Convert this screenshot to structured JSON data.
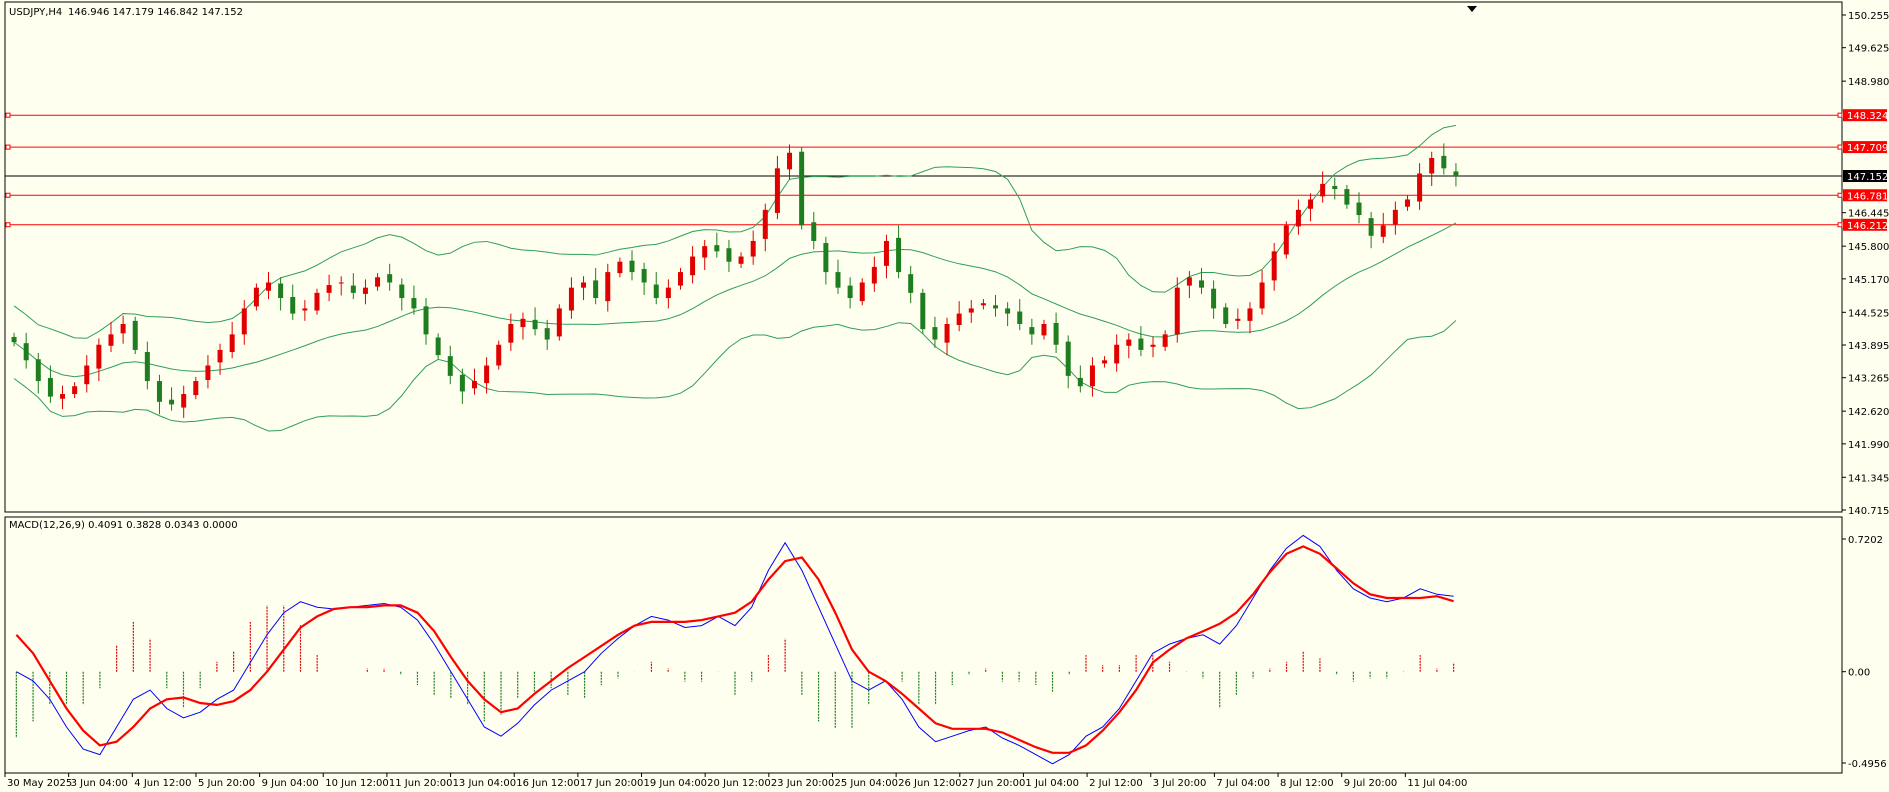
{
  "header": {
    "symbol_tf": "USDJPY,H4",
    "ohlc": "146.946 147.179 146.842 147.152"
  },
  "macd_header": {
    "label": "MACD(12,26,9) 0.4091 0.3828 0.0343 0.0000"
  },
  "price_axis": {
    "ticks": [
      "150.255",
      "149.625",
      "148.980",
      "148.324",
      "147.709",
      "147.152",
      "146.781",
      "146.445",
      "146.212",
      "145.800",
      "145.170",
      "144.525",
      "143.895",
      "143.265",
      "142.620",
      "141.990",
      "141.345",
      "140.715"
    ],
    "tick_values": [
      150.255,
      149.625,
      148.98,
      148.324,
      147.709,
      147.152,
      146.781,
      146.445,
      146.212,
      145.8,
      145.17,
      144.525,
      143.895,
      143.265,
      142.62,
      141.99,
      141.345,
      140.715
    ],
    "current_price": "147.152",
    "level_labels": [
      "148.324",
      "147.709",
      "146.781",
      "146.212"
    ]
  },
  "macd_axis": {
    "ticks": [
      "0.7202",
      "0.00",
      "-0.4956"
    ],
    "tick_values": [
      0.7202,
      0.0,
      -0.4956
    ]
  },
  "time_axis": {
    "labels": [
      "30 May 2025",
      "3 Jun 04:00",
      "4 Jun 12:00",
      "5 Jun 20:00",
      "9 Jun 04:00",
      "10 Jun 12:00",
      "11 Jun 20:00",
      "13 Jun 04:00",
      "16 Jun 12:00",
      "17 Jun 20:00",
      "19 Jun 04:00",
      "20 Jun 12:00",
      "23 Jun 20:00",
      "25 Jun 04:00",
      "26 Jun 12:00",
      "27 Jun 20:00",
      "1 Jul 04:00",
      "2 Jul 12:00",
      "3 Jul 20:00",
      "7 Jul 04:00",
      "8 Jul 12:00",
      "9 Jul 20:00",
      "11 Jul 04:00"
    ]
  },
  "colors": {
    "background": "#fffff0",
    "bull": "#e00000",
    "bear": "#1e7d1e",
    "bands": "#2e9e5a",
    "level": "#ff0000",
    "macd_line": "#0000ff",
    "signal_line": "#ff0000",
    "hist_pos": "#e00000",
    "hist_neg": "#1e7d1e"
  },
  "chart_data": {
    "type": "candlestick",
    "symbol": "USDJPY",
    "timeframe": "H4",
    "ylim": [
      140.715,
      150.255
    ],
    "horizontal_levels": [
      148.324,
      147.709,
      146.781,
      146.212
    ],
    "current_price": 147.152,
    "close_path": [
      143.95,
      143.6,
      143.2,
      142.9,
      142.95,
      143.1,
      143.5,
      143.9,
      144.1,
      144.3,
      143.8,
      143.2,
      142.8,
      142.75,
      142.95,
      143.2,
      143.5,
      143.8,
      144.1,
      144.6,
      145.0,
      145.1,
      144.8,
      144.5,
      144.6,
      144.9,
      145.05,
      145.1,
      144.9,
      145.0,
      145.2,
      145.1,
      144.8,
      144.6,
      144.1,
      143.7,
      143.3,
      143.0,
      143.2,
      143.5,
      143.9,
      144.3,
      144.4,
      144.2,
      144.0,
      144.6,
      145.0,
      145.1,
      144.8,
      145.3,
      145.5,
      145.3,
      145.1,
      144.8,
      145.0,
      145.3,
      145.6,
      145.8,
      145.7,
      145.5,
      145.6,
      145.9,
      146.5,
      147.3,
      147.6,
      146.2,
      145.9,
      145.3,
      145.0,
      144.8,
      145.1,
      145.4,
      145.9,
      145.3,
      144.9,
      144.2,
      144.0,
      144.3,
      144.5,
      144.6,
      144.7,
      144.6,
      144.5,
      144.3,
      144.1,
      144.3,
      143.9,
      143.3,
      143.1,
      143.5,
      143.6,
      143.9,
      144.0,
      143.8,
      143.9,
      144.1,
      145.0,
      145.2,
      145.0,
      144.6,
      144.3,
      144.4,
      144.6,
      145.1,
      145.7,
      146.2,
      146.5,
      146.7,
      147.0,
      146.9,
      146.6,
      146.4,
      146.0,
      146.2,
      146.5,
      146.7,
      147.2,
      147.5,
      147.3,
      147.152
    ],
    "bollinger": {
      "period": 20,
      "note": "upper/middle/lower bands drawn"
    },
    "macd": {
      "params": "12,26,9",
      "values": [
        0.4091,
        0.3828,
        0.0343,
        0.0
      ],
      "ylim": [
        -0.4956,
        0.7202
      ],
      "macd_path": [
        0.0,
        -0.05,
        -0.15,
        -0.3,
        -0.42,
        -0.45,
        -0.3,
        -0.15,
        -0.1,
        -0.2,
        -0.25,
        -0.22,
        -0.15,
        -0.1,
        0.05,
        0.2,
        0.32,
        0.38,
        0.35,
        0.34,
        0.35,
        0.36,
        0.37,
        0.35,
        0.28,
        0.15,
        0.0,
        -0.15,
        -0.3,
        -0.35,
        -0.28,
        -0.18,
        -0.1,
        -0.05,
        0.0,
        0.1,
        0.18,
        0.25,
        0.3,
        0.28,
        0.24,
        0.25,
        0.3,
        0.25,
        0.35,
        0.55,
        0.7,
        0.55,
        0.35,
        0.15,
        -0.05,
        -0.1,
        -0.05,
        -0.15,
        -0.3,
        -0.38,
        -0.35,
        -0.32,
        -0.3,
        -0.36,
        -0.4,
        -0.45,
        -0.5,
        -0.45,
        -0.35,
        -0.3,
        -0.2,
        -0.05,
        0.1,
        0.15,
        0.18,
        0.2,
        0.15,
        0.25,
        0.4,
        0.55,
        0.67,
        0.74,
        0.68,
        0.55,
        0.45,
        0.4,
        0.38,
        0.4,
        0.45,
        0.42,
        0.41
      ],
      "signal_path": [
        0.2,
        0.1,
        -0.05,
        -0.2,
        -0.32,
        -0.4,
        -0.38,
        -0.3,
        -0.2,
        -0.15,
        -0.14,
        -0.17,
        -0.18,
        -0.16,
        -0.1,
        0.0,
        0.12,
        0.24,
        0.3,
        0.34,
        0.35,
        0.35,
        0.36,
        0.36,
        0.32,
        0.22,
        0.08,
        -0.05,
        -0.15,
        -0.22,
        -0.2,
        -0.12,
        -0.05,
        0.02,
        0.08,
        0.14,
        0.2,
        0.25,
        0.27,
        0.27,
        0.27,
        0.28,
        0.3,
        0.32,
        0.38,
        0.5,
        0.6,
        0.62,
        0.5,
        0.32,
        0.12,
        0.0,
        -0.05,
        -0.12,
        -0.2,
        -0.28,
        -0.31,
        -0.31,
        -0.31,
        -0.33,
        -0.37,
        -0.41,
        -0.44,
        -0.44,
        -0.4,
        -0.32,
        -0.22,
        -0.1,
        0.05,
        0.12,
        0.18,
        0.22,
        0.26,
        0.32,
        0.42,
        0.54,
        0.64,
        0.68,
        0.64,
        0.56,
        0.48,
        0.42,
        0.4,
        0.4,
        0.4,
        0.41,
        0.3828
      ]
    }
  }
}
